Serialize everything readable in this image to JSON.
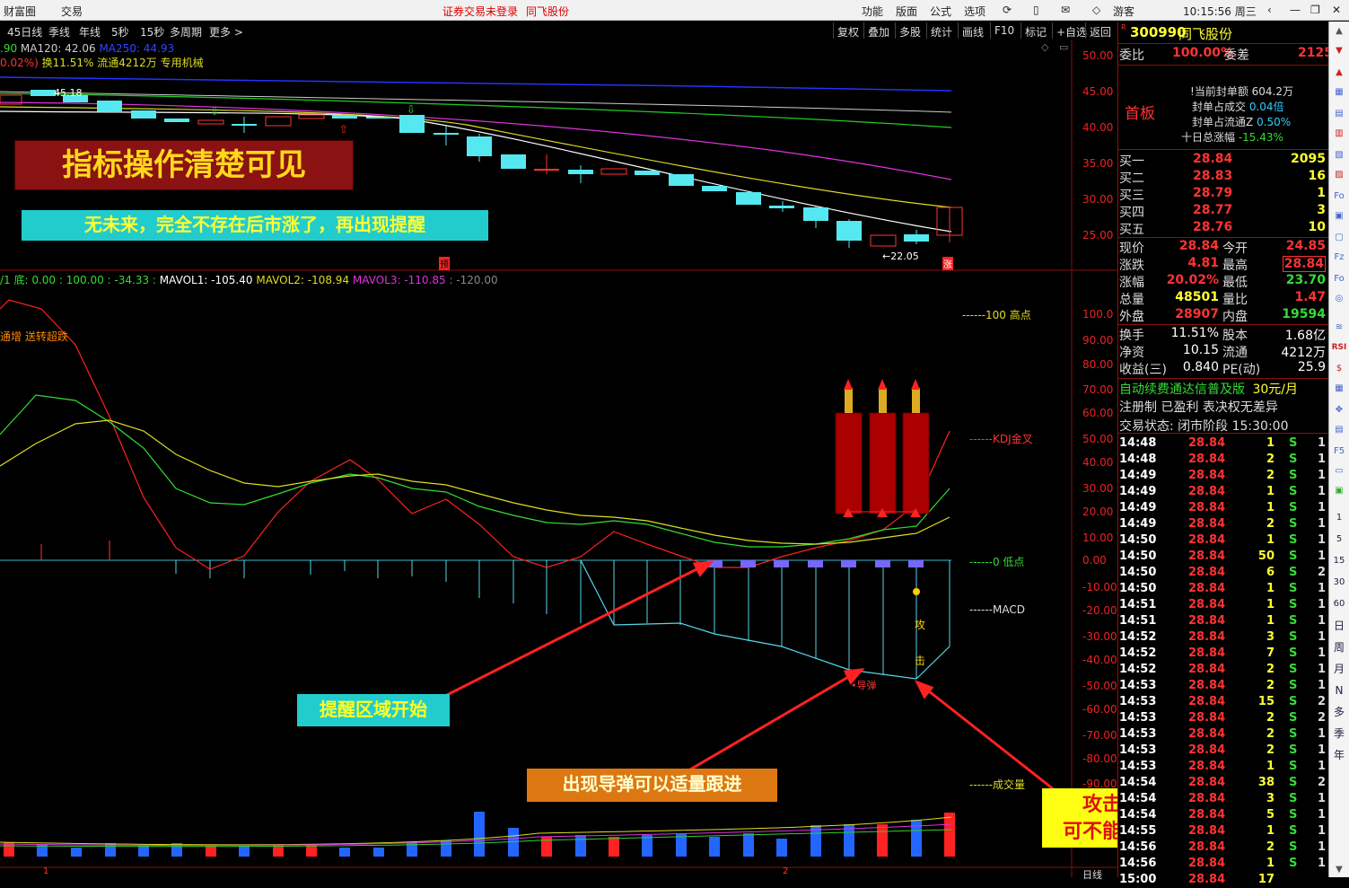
{
  "topbar": {
    "left_items": [
      "财富圈",
      "交易"
    ],
    "status": "证券交易未登录",
    "stock_title": "同飞股份",
    "menu": [
      "功能",
      "版面",
      "公式",
      "选项"
    ],
    "user": "游客",
    "clock": "10:15:56 周三"
  },
  "toolbar": {
    "periods": [
      "45日线",
      "季线",
      "年线",
      "5秒",
      "15秒",
      "多周期",
      "更多 >"
    ],
    "actions": [
      "复权",
      "叠加",
      "多股",
      "统计",
      "画线",
      "F10",
      "标记",
      "+自选",
      "返回"
    ]
  },
  "main_chart": {
    "info_line1": {
      "ma_prev": ".90",
      "ma120": "MA120: 42.06",
      "ma250": "MA250: 44.93"
    },
    "info_line2": {
      "pct": "0.02%)",
      "turnover": "换11.51% 流通4212万 专用机械"
    },
    "y_axis": [
      "50.00",
      "45.00",
      "40.00",
      "35.00",
      "30.00",
      "25.00"
    ],
    "high_label": "45.18",
    "low_label": "←22.05",
    "marker_yu": "预",
    "marker_zhang": "涨"
  },
  "indicator_panel": {
    "header": {
      "prefix": "/1  底: 0.00 : 100.00 : -34.33 :",
      "mavol1": "MAVOL1: -105.40",
      "mavol2": "MAVOL2: -108.94",
      "mavol3": "MAVOL3: -110.85",
      "suffix": ": -120.00"
    },
    "top_left_text": "通增 送转超跌",
    "y_axis": [
      "100.0",
      "90.00",
      "80.00",
      "70.00",
      "60.00",
      "50.00",
      "40.00",
      "30.00",
      "20.00",
      "10.00",
      "0.00",
      "-10.00",
      "-20.00",
      "-30.00",
      "-40.00",
      "-50.00",
      "-60.00",
      "-70.00",
      "-80.00",
      "-90.00"
    ],
    "level_labels": {
      "high": "100 高点",
      "kdj": "KDJ金叉",
      "low": "0 低点",
      "macd": "MACD",
      "volume": "成交量"
    },
    "attack_chars": [
      "攻",
      "击"
    ],
    "missile_label": "•导弹"
  },
  "bottom_axis": {
    "tick1": "1",
    "tick2": "2",
    "period": "日线"
  },
  "callouts": {
    "title": "指标操作清楚可见",
    "subtitle": "无未来，完全不存在后市涨了，再出现提醒",
    "zone_start": "提醒区域开始",
    "missile": "出现导弹可以适量跟进",
    "attack_line1": "攻击时，",
    "attack_line2": "可不能再等待"
  },
  "quote": {
    "code": "300990",
    "name": "同飞股份",
    "weibi_label": "委比",
    "weibi_value": "100.00%",
    "weicha_label": "委差",
    "weicha_value": "2125",
    "board_label": "首板",
    "seal_info": [
      {
        "label": "当前封单额",
        "value": "604.2万"
      },
      {
        "label": "封单占成交",
        "value": "0.04倍"
      },
      {
        "label": "封单占流通Z",
        "value": "0.50%"
      },
      {
        "label": "十日总涨幅",
        "value": "-15.43%"
      }
    ],
    "bids": [
      {
        "label": "买一",
        "price": "28.84",
        "vol": "2095"
      },
      {
        "label": "买二",
        "price": "28.83",
        "vol": "16"
      },
      {
        "label": "买三",
        "price": "28.79",
        "vol": "1"
      },
      {
        "label": "买四",
        "price": "28.77",
        "vol": "3"
      },
      {
        "label": "买五",
        "price": "28.76",
        "vol": "10"
      }
    ],
    "stats": [
      {
        "l1": "现价",
        "v1": "28.84",
        "l2": "今开",
        "v2": "24.85"
      },
      {
        "l1": "涨跌",
        "v1": "4.81",
        "l2": "最高",
        "v2": "28.84"
      },
      {
        "l1": "涨幅",
        "v1": "20.02%",
        "l2": "最低",
        "v2": "23.70"
      },
      {
        "l1": "总量",
        "v1": "48501",
        "l2": "量比",
        "v2": "1.47"
      },
      {
        "l1": "外盘",
        "v1": "28907",
        "l2": "内盘",
        "v2": "19594"
      }
    ],
    "stats2": [
      {
        "l1": "换手",
        "v1": "11.51%",
        "l2": "股本",
        "v2": "1.68亿"
      },
      {
        "l1": "净资",
        "v1": "10.15",
        "l2": "流通",
        "v2": "4212万"
      },
      {
        "l1": "收益(三)",
        "v1": "0.840",
        "l2": "PE(动)",
        "v2": "25.9"
      }
    ],
    "ad_line1": "自动续费通达信普及版",
    "ad_price": "30元/月",
    "ad_line2": "注册制 已盈利 表决权无差异",
    "trade_status": "交易状态: 闭市阶段 15:30:00"
  },
  "ticks": [
    {
      "t": "14:48",
      "p": "28.84",
      "v": "1",
      "s": "S",
      "n": "1"
    },
    {
      "t": "14:48",
      "p": "28.84",
      "v": "2",
      "s": "S",
      "n": "1"
    },
    {
      "t": "14:49",
      "p": "28.84",
      "v": "2",
      "s": "S",
      "n": "1"
    },
    {
      "t": "14:49",
      "p": "28.84",
      "v": "1",
      "s": "S",
      "n": "1"
    },
    {
      "t": "14:49",
      "p": "28.84",
      "v": "1",
      "s": "S",
      "n": "1"
    },
    {
      "t": "14:49",
      "p": "28.84",
      "v": "2",
      "s": "S",
      "n": "1"
    },
    {
      "t": "14:50",
      "p": "28.84",
      "v": "1",
      "s": "S",
      "n": "1"
    },
    {
      "t": "14:50",
      "p": "28.84",
      "v": "50",
      "s": "S",
      "n": "1"
    },
    {
      "t": "14:50",
      "p": "28.84",
      "v": "6",
      "s": "S",
      "n": "2"
    },
    {
      "t": "14:50",
      "p": "28.84",
      "v": "1",
      "s": "S",
      "n": "1"
    },
    {
      "t": "14:51",
      "p": "28.84",
      "v": "1",
      "s": "S",
      "n": "1"
    },
    {
      "t": "14:51",
      "p": "28.84",
      "v": "1",
      "s": "S",
      "n": "1"
    },
    {
      "t": "14:52",
      "p": "28.84",
      "v": "3",
      "s": "S",
      "n": "1"
    },
    {
      "t": "14:52",
      "p": "28.84",
      "v": "7",
      "s": "S",
      "n": "1"
    },
    {
      "t": "14:52",
      "p": "28.84",
      "v": "2",
      "s": "S",
      "n": "1"
    },
    {
      "t": "14:53",
      "p": "28.84",
      "v": "2",
      "s": "S",
      "n": "1"
    },
    {
      "t": "14:53",
      "p": "28.84",
      "v": "15",
      "s": "S",
      "n": "2"
    },
    {
      "t": "14:53",
      "p": "28.84",
      "v": "2",
      "s": "S",
      "n": "2"
    },
    {
      "t": "14:53",
      "p": "28.84",
      "v": "2",
      "s": "S",
      "n": "1"
    },
    {
      "t": "14:53",
      "p": "28.84",
      "v": "2",
      "s": "S",
      "n": "1"
    },
    {
      "t": "14:53",
      "p": "28.84",
      "v": "1",
      "s": "S",
      "n": "1"
    },
    {
      "t": "14:54",
      "p": "28.84",
      "v": "38",
      "s": "S",
      "n": "2"
    },
    {
      "t": "14:54",
      "p": "28.84",
      "v": "3",
      "s": "S",
      "n": "1"
    },
    {
      "t": "14:54",
      "p": "28.84",
      "v": "5",
      "s": "S",
      "n": "1"
    },
    {
      "t": "14:55",
      "p": "28.84",
      "v": "1",
      "s": "S",
      "n": "1"
    },
    {
      "t": "14:56",
      "p": "28.84",
      "v": "2",
      "s": "S",
      "n": "1"
    },
    {
      "t": "14:56",
      "p": "28.84",
      "v": "1",
      "s": "S",
      "n": "1"
    },
    {
      "t": "15:00",
      "p": "28.84",
      "v": "17",
      "s": "",
      "n": ""
    }
  ],
  "side_tools": [
    "日",
    "周",
    "月",
    "N",
    "多",
    "季",
    "年"
  ],
  "side_numbers": [
    "1",
    "5",
    "15",
    "30",
    "60"
  ]
}
